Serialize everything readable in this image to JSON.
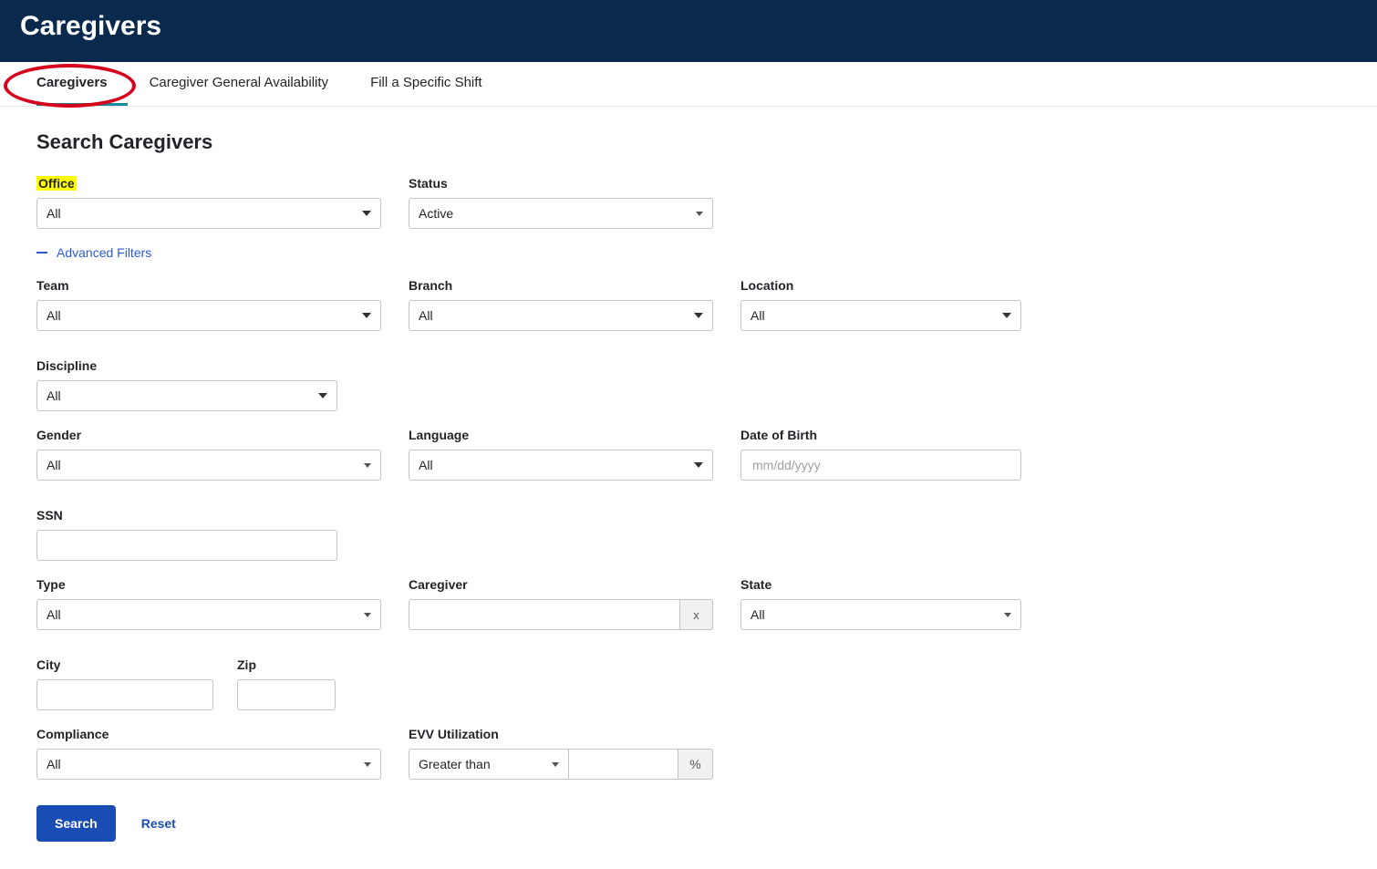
{
  "header": {
    "title": "Caregivers"
  },
  "tabs": [
    {
      "label": "Caregivers",
      "active": true
    },
    {
      "label": "Caregiver General Availability",
      "active": false
    },
    {
      "label": "Fill a Specific Shift",
      "active": false
    }
  ],
  "section_title": "Search Caregivers",
  "advanced_label": "Advanced Filters",
  "filters": {
    "office": {
      "label": "Office",
      "value": "All"
    },
    "status": {
      "label": "Status",
      "value": "Active"
    },
    "team": {
      "label": "Team",
      "value": "All"
    },
    "branch": {
      "label": "Branch",
      "value": "All"
    },
    "location": {
      "label": "Location",
      "value": "All"
    },
    "discipline": {
      "label": "Discipline",
      "value": "All"
    },
    "gender": {
      "label": "Gender",
      "value": "All"
    },
    "language": {
      "label": "Language",
      "value": "All"
    },
    "dob": {
      "label": "Date of Birth",
      "placeholder": "mm/dd/yyyy",
      "value": ""
    },
    "ssn": {
      "label": "SSN",
      "value": ""
    },
    "type": {
      "label": "Type",
      "value": "All"
    },
    "caregiver": {
      "label": "Caregiver",
      "value": "",
      "clear": "x"
    },
    "state": {
      "label": "State",
      "value": "All"
    },
    "city": {
      "label": "City",
      "value": ""
    },
    "zip": {
      "label": "Zip",
      "value": ""
    },
    "compliance": {
      "label": "Compliance",
      "value": "All"
    },
    "evv": {
      "label": "EVV Utilization",
      "comparator": "Greater than",
      "value": "",
      "suffix": "%"
    }
  },
  "actions": {
    "search": "Search",
    "reset": "Reset"
  }
}
